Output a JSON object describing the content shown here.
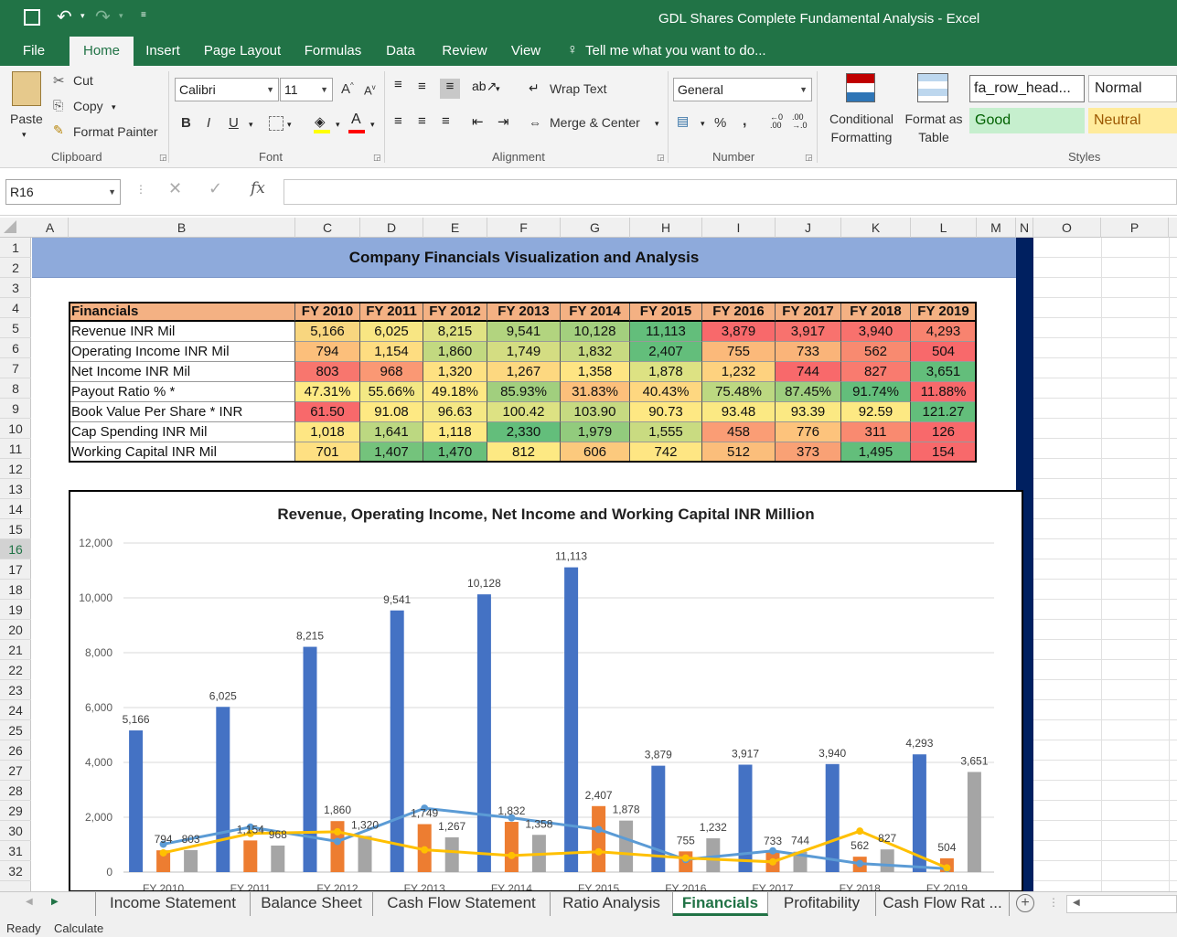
{
  "window": {
    "title": "GDL Shares Complete Fundamental Analysis  -  Excel"
  },
  "ribbon_tabs": [
    {
      "label": "File"
    },
    {
      "label": "Home"
    },
    {
      "label": "Insert"
    },
    {
      "label": "Page Layout"
    },
    {
      "label": "Formulas"
    },
    {
      "label": "Data"
    },
    {
      "label": "Review"
    },
    {
      "label": "View"
    },
    {
      "label": "Tell me what you want to do..."
    }
  ],
  "clipboard": {
    "paste": "Paste",
    "cut": "Cut",
    "copy": "Copy",
    "format_painter": "Format Painter",
    "group": "Clipboard"
  },
  "font": {
    "name": "Calibri",
    "size": "11",
    "bold": "B",
    "italic": "I",
    "underline": "U",
    "group": "Font"
  },
  "alignment": {
    "wrap_text": "Wrap Text",
    "merge_center": "Merge & Center",
    "group": "Alignment"
  },
  "number": {
    "format": "General",
    "percent": "%",
    "comma": ",",
    "group": "Number"
  },
  "styles": {
    "conditional_formatting": "Conditional Formatting",
    "format_as_table": "Format as Table",
    "style_cells": [
      "fa_row_head...",
      "Normal",
      "Good",
      "Neutral"
    ],
    "group": "Styles"
  },
  "formula_bar": {
    "name_box": "R16",
    "fx": "fx",
    "value": ""
  },
  "columns": [
    "A",
    "B",
    "C",
    "D",
    "E",
    "F",
    "G",
    "H",
    "I",
    "J",
    "K",
    "L",
    "M",
    "N",
    "O",
    "P"
  ],
  "rows": [
    "1",
    "2",
    "3",
    "4",
    "5",
    "6",
    "7",
    "8",
    "9",
    "10",
    "11",
    "12",
    "13",
    "14",
    "15",
    "16",
    "17",
    "18",
    "19",
    "20",
    "21",
    "22",
    "23",
    "24",
    "25",
    "26",
    "27",
    "28",
    "29",
    "30",
    "31",
    "32"
  ],
  "selected_row": "16",
  "sheet": {
    "banner_title": "Company Financials Visualization and Analysis",
    "table": {
      "headers": [
        "Financials",
        "FY 2010",
        "FY 2011",
        "FY 2012",
        "FY 2013",
        "FY 2014",
        "FY 2015",
        "FY 2016",
        "FY 2017",
        "FY 2018",
        "FY 2019"
      ],
      "rows": [
        {
          "label": "Revenue INR Mil",
          "values": [
            "5,166",
            "6,025",
            "8,215",
            "9,541",
            "10,128",
            "11,113",
            "3,879",
            "3,917",
            "3,940",
            "4,293"
          ],
          "colors": [
            "#f8d67f",
            "#f8e683",
            "#e0e283",
            "#b2d47f",
            "#a3cf7e",
            "#63be7b",
            "#f8696b",
            "#f8726e",
            "#f8716d",
            "#f8836f"
          ]
        },
        {
          "label": "Operating Income INR Mil",
          "values": [
            "794",
            "1,154",
            "1,860",
            "1,749",
            "1,832",
            "2,407",
            "755",
            "733",
            "562",
            "504"
          ],
          "colors": [
            "#fcbf7b",
            "#fedd81",
            "#c2d980",
            "#d4dd82",
            "#c8da81",
            "#63be7b",
            "#fbb97a",
            "#fab479",
            "#f88a70",
            "#f8696b"
          ]
        },
        {
          "label": "Net Income INR Mil",
          "values": [
            "803",
            "968",
            "1,320",
            "1,267",
            "1,358",
            "1,878",
            "1,232",
            "744",
            "827",
            "3,651"
          ],
          "colors": [
            "#f8766e",
            "#fa9874",
            "#fee182",
            "#fdd880",
            "#fee583",
            "#dde283",
            "#fed27f",
            "#f8696b",
            "#f97b6f",
            "#63be7b"
          ]
        },
        {
          "label": "Payout Ratio % *",
          "values": [
            "47.31%",
            "55.66%",
            "49.18%",
            "85.93%",
            "31.83%",
            "40.43%",
            "75.48%",
            "87.45%",
            "91.74%",
            "11.88%"
          ],
          "colors": [
            "#feea84",
            "#f3e884",
            "#fee984",
            "#a1cf7e",
            "#fcbf7b",
            "#fed780",
            "#bcd881",
            "#9ece7e",
            "#63be7b",
            "#f8696b"
          ]
        },
        {
          "label": "Book Value Per Share * INR",
          "values": [
            "61.50",
            "91.08",
            "96.63",
            "100.42",
            "103.90",
            "90.73",
            "93.48",
            "93.39",
            "92.59",
            "121.27"
          ],
          "colors": [
            "#f8696b",
            "#fee983",
            "#f5e884",
            "#dde283",
            "#c6da81",
            "#fee883",
            "#fbe983",
            "#fbe983",
            "#fde983",
            "#63be7b"
          ]
        },
        {
          "label": "Cap Spending INR Mil",
          "values": [
            "1,018",
            "1,641",
            "1,118",
            "2,330",
            "1,979",
            "1,555",
            "458",
            "776",
            "311",
            "126"
          ],
          "colors": [
            "#fee683",
            "#bcd881",
            "#fde983",
            "#63be7b",
            "#92cb7d",
            "#c9db81",
            "#fa9d75",
            "#fdc37c",
            "#f98a70",
            "#f8696b"
          ]
        },
        {
          "label": "Working Capital INR Mil",
          "values": [
            "701",
            "1,407",
            "1,470",
            "812",
            "606",
            "742",
            "512",
            "373",
            "1,495",
            "154"
          ],
          "colors": [
            "#fee082",
            "#74c37c",
            "#68bf7b",
            "#fde983",
            "#fcc97d",
            "#fee683",
            "#fbbe7b",
            "#f9a175",
            "#63be7b",
            "#f8696b"
          ]
        }
      ]
    }
  },
  "chart_data": {
    "type": "bar",
    "title": "Revenue, Operating Income, Net Income and Working Capital INR Million",
    "categories": [
      "FY 2010",
      "FY 2011",
      "FY 2012",
      "FY 2013",
      "FY 2014",
      "FY 2015",
      "FY 2016",
      "FY 2017",
      "FY 2018",
      "FY 2019"
    ],
    "ylim": [
      0,
      12000
    ],
    "yticks": [
      "0",
      "2,000",
      "4,000",
      "6,000",
      "8,000",
      "10,000",
      "12,000"
    ],
    "grid": true,
    "series": [
      {
        "kind": "bar",
        "color": "#4472c4",
        "values": [
          5166,
          6025,
          8215,
          9541,
          10128,
          11113,
          3879,
          3917,
          3940,
          4293
        ],
        "labels": [
          "5,166",
          "6,025",
          "8,215",
          "9,541",
          "10,128",
          "11,113",
          "3,879",
          "3,917",
          "3,940",
          "4,293"
        ]
      },
      {
        "kind": "bar",
        "color": "#ed7d31",
        "values": [
          794,
          1154,
          1860,
          1749,
          1832,
          2407,
          755,
          733,
          562,
          504
        ],
        "labels": [
          "794",
          "1,154",
          "1,860",
          "1,749",
          "1,832",
          "2,407",
          "755",
          "733",
          "562",
          "504"
        ]
      },
      {
        "kind": "bar",
        "color": "#a5a5a5",
        "values": [
          803,
          968,
          1320,
          1267,
          1358,
          1878,
          1232,
          744,
          827,
          3651
        ],
        "labels": [
          "803",
          "968",
          "1,320",
          "1,267",
          "1,358",
          "1,878",
          "1,232",
          "744",
          "827",
          "3,651"
        ]
      },
      {
        "kind": "line",
        "color": "#5b9bd5",
        "values": [
          1018,
          1641,
          1118,
          2330,
          1979,
          1555,
          458,
          776,
          311,
          126
        ]
      },
      {
        "kind": "line",
        "color": "#ffc000",
        "values": [
          701,
          1407,
          1470,
          812,
          606,
          742,
          512,
          373,
          1495,
          154
        ]
      }
    ]
  },
  "sheet_tabs": [
    {
      "label": "Income Statement"
    },
    {
      "label": "Balance Sheet"
    },
    {
      "label": "Cash Flow Statement"
    },
    {
      "label": "Ratio Analysis"
    },
    {
      "label": "Financials"
    },
    {
      "label": "Profitability"
    },
    {
      "label": "Cash Flow Rat ..."
    }
  ],
  "status": {
    "ready": "Ready",
    "calculate": "Calculate"
  }
}
